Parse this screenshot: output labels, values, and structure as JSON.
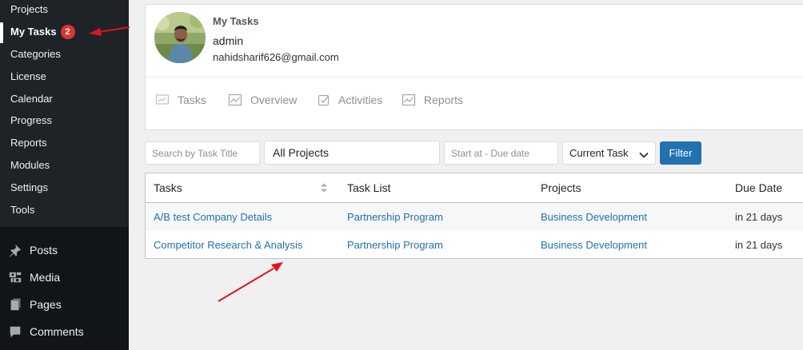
{
  "sidebar": {
    "submenu": [
      {
        "label": "Projects"
      },
      {
        "label": "My Tasks",
        "badge": "2"
      },
      {
        "label": "Categories"
      },
      {
        "label": "License"
      },
      {
        "label": "Calendar"
      },
      {
        "label": "Progress"
      },
      {
        "label": "Reports"
      },
      {
        "label": "Modules"
      },
      {
        "label": "Settings"
      },
      {
        "label": "Tools"
      }
    ],
    "menu": [
      {
        "label": "Posts",
        "icon": "pushpin-icon"
      },
      {
        "label": "Media",
        "icon": "media-icon"
      },
      {
        "label": "Pages",
        "icon": "pages-icon"
      },
      {
        "label": "Comments",
        "icon": "comments-icon"
      }
    ]
  },
  "profile": {
    "section_title": "My Tasks",
    "name": "admin",
    "email": "nahidsharif626@gmail.com"
  },
  "tabs": [
    {
      "label": "Tasks",
      "icon": "tasks-icon"
    },
    {
      "label": "Overview",
      "icon": "chart-icon"
    },
    {
      "label": "Activities",
      "icon": "activities-icon"
    },
    {
      "label": "Reports",
      "icon": "reports-icon"
    }
  ],
  "filters": {
    "search_placeholder": "Search by Task Title",
    "project_value": "All Projects",
    "date_placeholder": "Start at - Due date",
    "task_select_value": "Current Task",
    "filter_label": "Filter"
  },
  "table": {
    "columns": [
      "Tasks",
      "Task List",
      "Projects",
      "Due Date"
    ],
    "rows": [
      [
        "A/B test Company Details",
        "Partnership Program",
        "Business Development",
        "in 21 days"
      ],
      [
        "Competitor Research & Analysis",
        "Partnership Program",
        "Business Development",
        "in 21 days"
      ]
    ]
  },
  "colors": {
    "sidebar_bg": "#1d2327",
    "accent": "#2271b1",
    "badge": "#d63638",
    "annotation_arrow": "#e0141e"
  }
}
